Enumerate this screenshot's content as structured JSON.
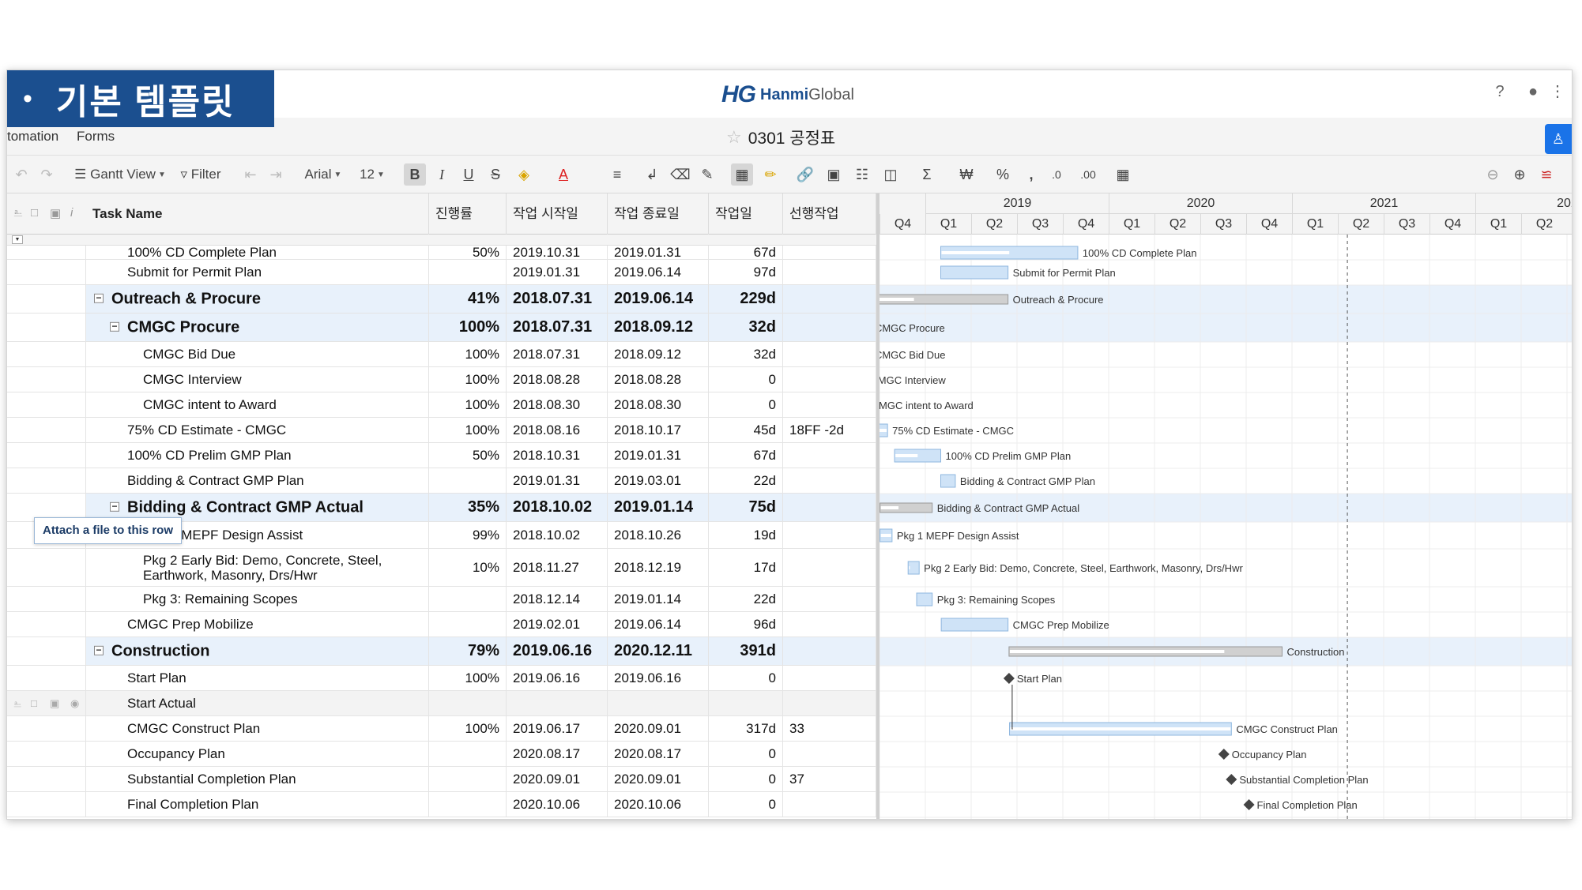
{
  "banner": {
    "bullet": "•",
    "text": "기본 템플릿"
  },
  "header": {
    "logo_mark": "HG",
    "logo_brand": "Hanmi",
    "logo_suffix": "Global",
    "icons": [
      "help-icon",
      "bell-icon",
      "apps-grid-icon"
    ]
  },
  "menu": {
    "items": [
      "tomation",
      "Forms"
    ],
    "sheet_title": "0301 공정표"
  },
  "toolbar": {
    "gantt_view": "Gantt View",
    "filter": "Filter",
    "font": "Arial",
    "font_size": "12"
  },
  "columns": {
    "task": "Task Name",
    "progress": "진행률",
    "start": "작업 시작일",
    "end": "작업 종료일",
    "duration": "작업일",
    "pred": "선행작업"
  },
  "tooltip": "Attach a file to this row",
  "timeline": {
    "years": [
      "2019",
      "2020",
      "2021",
      "202"
    ],
    "quarters": [
      "Q4",
      "Q1",
      "Q2",
      "Q3",
      "Q4",
      "Q1",
      "Q2",
      "Q3",
      "Q4",
      "Q1",
      "Q2",
      "Q3",
      "Q4",
      "Q1",
      "Q2"
    ]
  },
  "rows": [
    {
      "name": "100% CD Complete Plan",
      "indent": 2,
      "pct": "50%",
      "start": "2019.10.31",
      "end": "2019.01.31",
      "dur": "67d",
      "pred": "",
      "bar": "100% CD Complete Plan"
    },
    {
      "name": "Submit for Permit Plan",
      "indent": 2,
      "pct": "",
      "start": "2019.01.31",
      "end": "2019.06.14",
      "dur": "97d",
      "pred": "",
      "bar": "Submit for Permit Plan"
    },
    {
      "name": "Outreach & Procure",
      "indent": 1,
      "parent": true,
      "pct": "41%",
      "start": "2018.07.31",
      "end": "2019.06.14",
      "dur": "229d",
      "pred": "",
      "bar": "Outreach & Procure"
    },
    {
      "name": "CMGC Procure",
      "indent": 2,
      "parent": true,
      "pct": "100%",
      "start": "2018.07.31",
      "end": "2018.09.12",
      "dur": "32d",
      "pred": "",
      "bar": "CMGC Procure"
    },
    {
      "name": "CMGC Bid Due",
      "indent": 3,
      "pct": "100%",
      "start": "2018.07.31",
      "end": "2018.09.12",
      "dur": "32d",
      "pred": "",
      "bar": "CMGC Bid Due"
    },
    {
      "name": "CMGC Interview",
      "indent": 3,
      "pct": "100%",
      "start": "2018.08.28",
      "end": "2018.08.28",
      "dur": "0",
      "pred": "",
      "bar": "CMGC Interview"
    },
    {
      "name": "CMGC intent to Award",
      "indent": 3,
      "pct": "100%",
      "start": "2018.08.30",
      "end": "2018.08.30",
      "dur": "0",
      "pred": "",
      "bar": "CMGC intent to Award"
    },
    {
      "name": "75% CD Estimate - CMGC",
      "indent": 2,
      "pct": "100%",
      "start": "2018.08.16",
      "end": "2018.10.17",
      "dur": "45d",
      "pred": "18FF -2d",
      "bar": "75% CD Estimate - CMGC"
    },
    {
      "name": "100% CD Prelim GMP Plan",
      "indent": 2,
      "pct": "50%",
      "start": "2018.10.31",
      "end": "2019.01.31",
      "dur": "67d",
      "pred": "",
      "bar": "100% CD Prelim GMP Plan"
    },
    {
      "name": "Bidding & Contract GMP Plan",
      "indent": 2,
      "pct": "",
      "start": "2019.01.31",
      "end": "2019.03.01",
      "dur": "22d",
      "pred": "",
      "bar": "Bidding & Contract GMP Plan"
    },
    {
      "name": "Bidding & Contract GMP Actual",
      "indent": 2,
      "parent": true,
      "pct": "35%",
      "start": "2018.10.02",
      "end": "2019.01.14",
      "dur": "75d",
      "pred": "",
      "bar": "Bidding & Contract GMP Actual"
    },
    {
      "name": "Pkg 1 MEPF Design Assist",
      "indent": 3,
      "pct": "99%",
      "start": "2018.10.02",
      "end": "2018.10.26",
      "dur": "19d",
      "pred": "",
      "bar": "Pkg 1 MEPF Design Assist"
    },
    {
      "name": "Pkg 2 Early Bid: Demo, Concrete, Steel, Earthwork, Masonry, Drs/Hwr",
      "indent": 3,
      "pct": "10%",
      "start": "2018.11.27",
      "end": "2018.12.19",
      "dur": "17d",
      "pred": "",
      "bar": "Pkg 2 Early Bid: Demo, Concrete, Steel, Earthwork, Masonry, Drs/Hwr"
    },
    {
      "name": "Pkg 3: Remaining Scopes",
      "indent": 3,
      "pct": "",
      "start": "2018.12.14",
      "end": "2019.01.14",
      "dur": "22d",
      "pred": "",
      "bar": "Pkg 3: Remaining Scopes"
    },
    {
      "name": "CMGC Prep Mobilize",
      "indent": 2,
      "pct": "",
      "start": "2019.02.01",
      "end": "2019.06.14",
      "dur": "96d",
      "pred": "",
      "bar": "CMGC Prep Mobilize"
    },
    {
      "name": "Construction",
      "indent": 1,
      "parent": true,
      "pct": "79%",
      "start": "2019.06.16",
      "end": "2020.12.11",
      "dur": "391d",
      "pred": "",
      "bar": "Construction"
    },
    {
      "name": "Start Plan",
      "indent": 2,
      "pct": "100%",
      "start": "2019.06.16",
      "end": "2019.06.16",
      "dur": "0",
      "pred": "",
      "bar": "Start Plan"
    },
    {
      "name": "Start Actual",
      "indent": 2,
      "pct": "",
      "start": "",
      "end": "",
      "dur": "",
      "pred": "",
      "bar": ""
    },
    {
      "name": "CMGC Construct Plan",
      "indent": 2,
      "pct": "100%",
      "start": "2019.06.17",
      "end": "2020.09.01",
      "dur": "317d",
      "pred": "33",
      "bar": "CMGC Construct Plan"
    },
    {
      "name": "Occupancy Plan",
      "indent": 2,
      "pct": "",
      "start": "2020.08.17",
      "end": "2020.08.17",
      "dur": "0",
      "pred": "",
      "bar": "Occupancy Plan"
    },
    {
      "name": "Substantial Completion Plan",
      "indent": 2,
      "pct": "",
      "start": "2020.09.01",
      "end": "2020.09.01",
      "dur": "0",
      "pred": "37",
      "bar": "Substantial Completion Plan"
    },
    {
      "name": "Final Completion Plan",
      "indent": 2,
      "pct": "",
      "start": "2020.10.06",
      "end": "2020.10.06",
      "dur": "0",
      "pred": "",
      "bar": "Final Completion Plan"
    }
  ]
}
